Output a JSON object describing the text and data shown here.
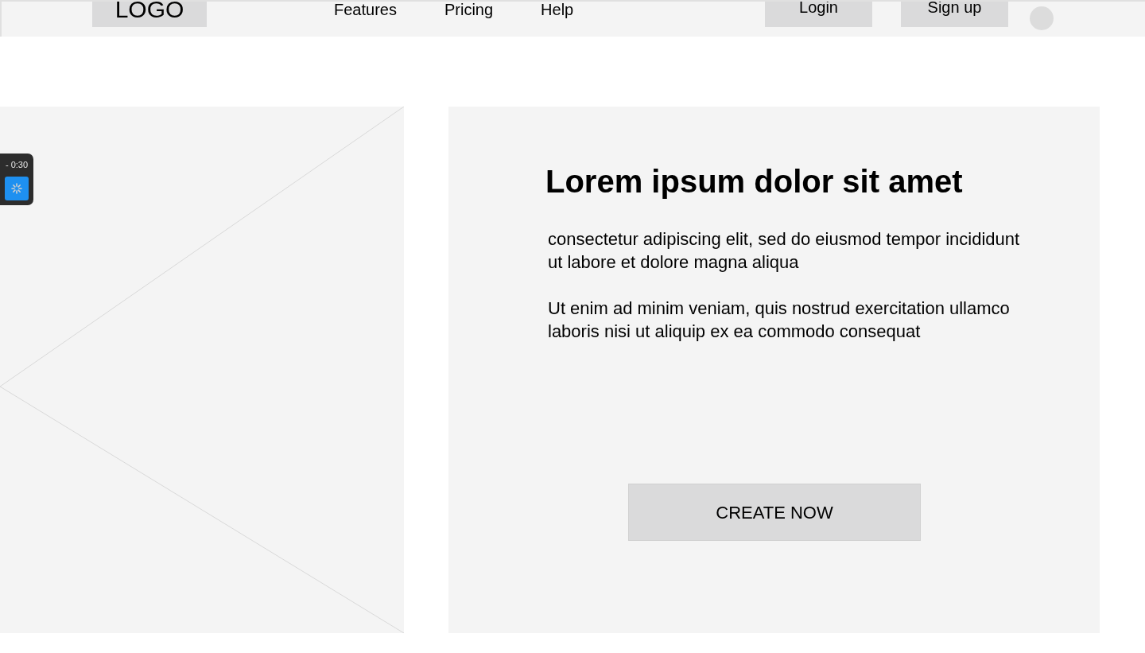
{
  "header": {
    "logo": "LOGO",
    "nav": [
      "Features",
      "Pricing",
      "Help"
    ],
    "buttons": [
      "Login",
      "Sign up"
    ]
  },
  "timer": {
    "time": "- 0:30"
  },
  "hero": {
    "title": "Lorem ipsum dolor sit amet",
    "paragraphs": [
      "consectetur adipiscing elit, sed do eiusmod tempor incididunt ut labore et dolore magna aliqua",
      "Ut enim ad minim veniam, quis nostrud exercitation ullamco laboris nisi ut aliquip ex ea commodo consequat"
    ],
    "button": "CREATE NOW"
  }
}
